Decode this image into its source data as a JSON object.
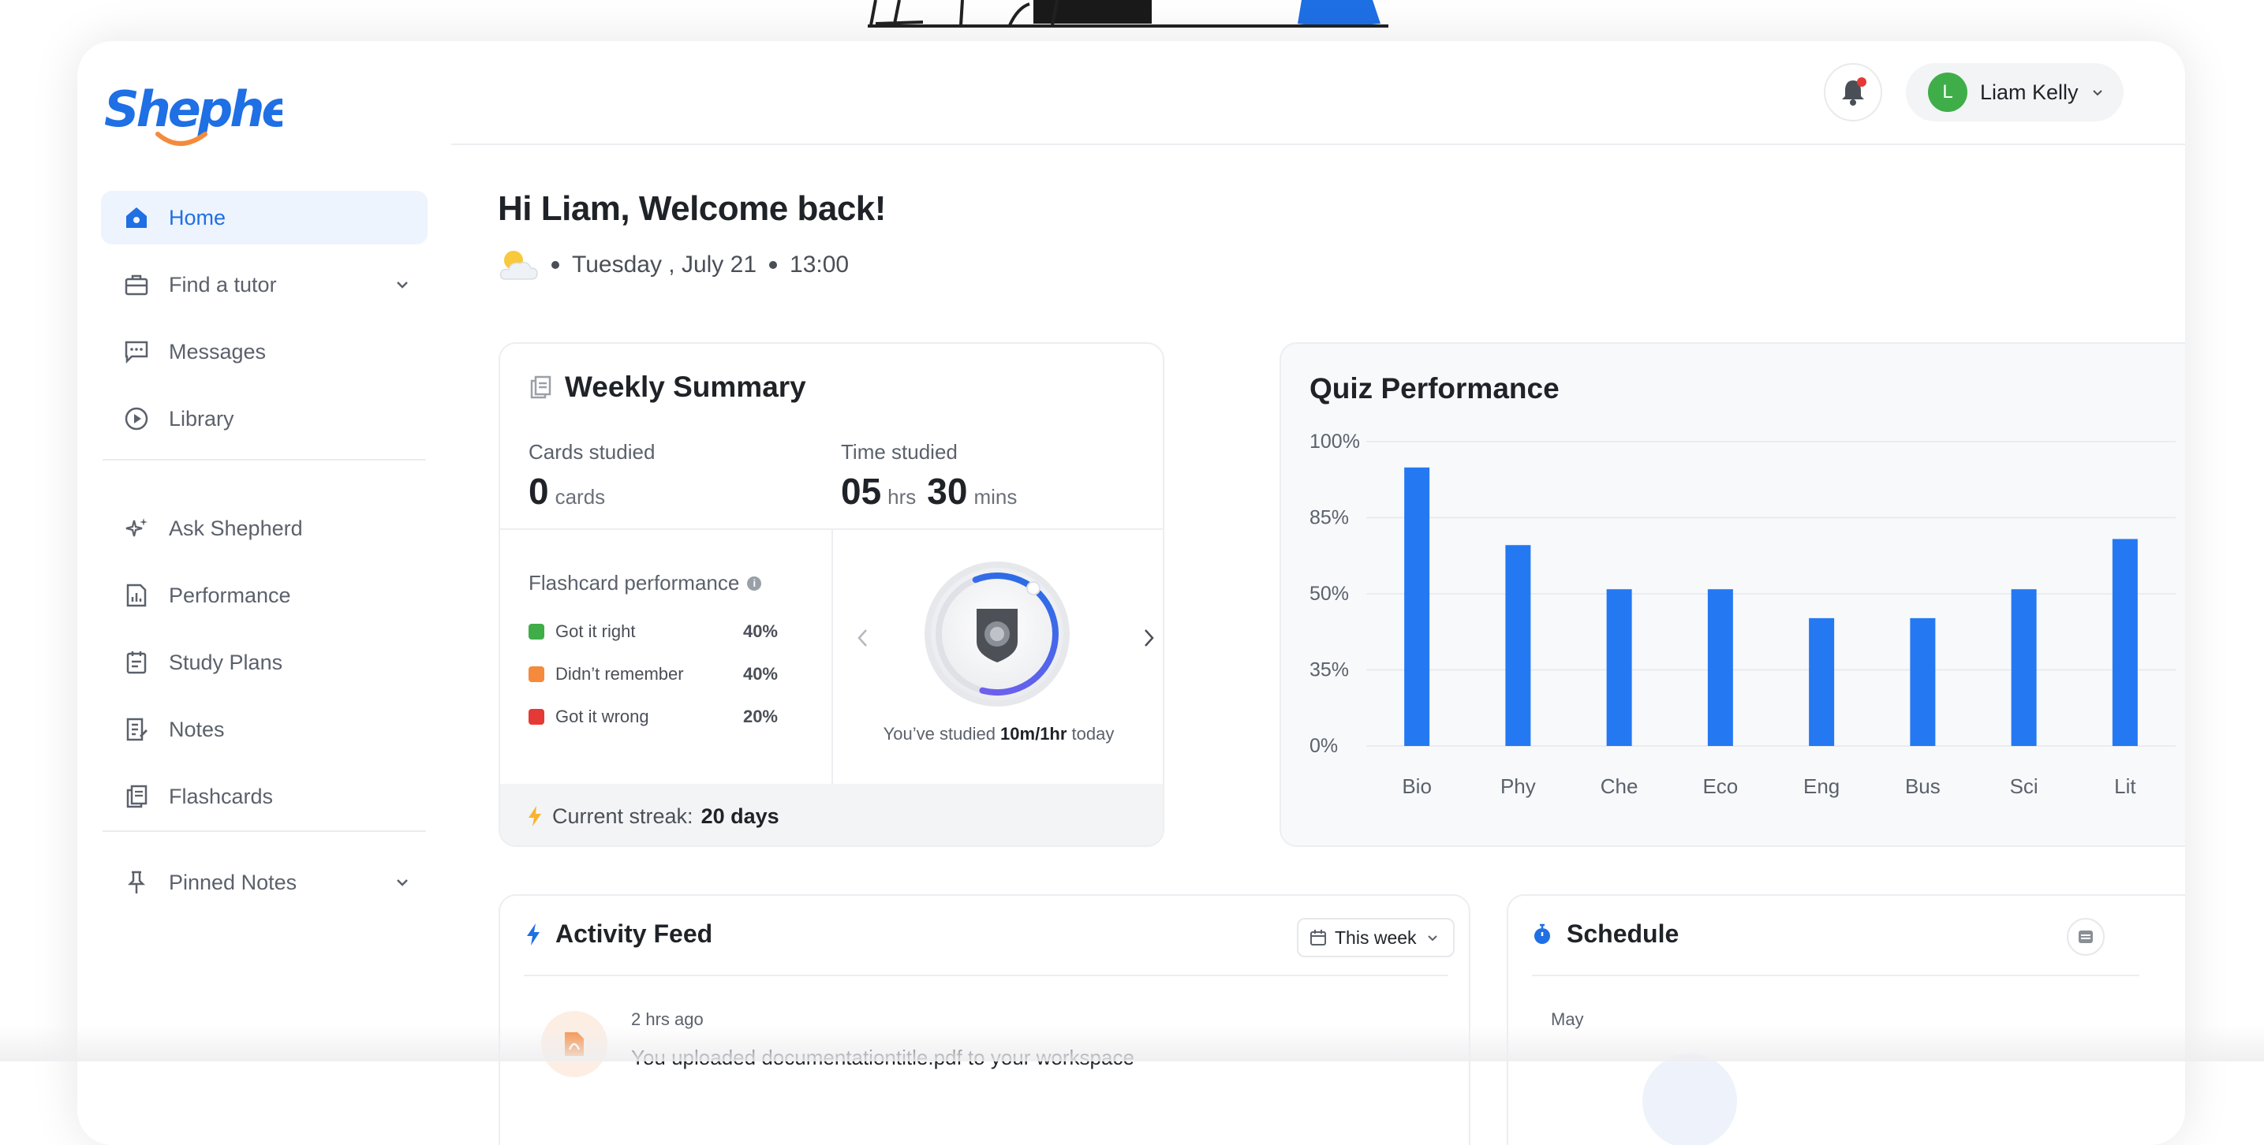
{
  "brand": {
    "name": "Shepherd"
  },
  "header": {
    "notification_icon": "bell-icon",
    "user": {
      "initial": "L",
      "name": "Liam Kelly",
      "avatar_color": "#3fae49"
    }
  },
  "sidebar": {
    "items": [
      {
        "label": "Home",
        "icon": "home-icon",
        "active": true
      },
      {
        "label": "Find a tutor",
        "icon": "briefcase-icon",
        "expandable": true
      },
      {
        "label": "Messages",
        "icon": "chat-icon"
      },
      {
        "label": "Library",
        "icon": "play-circle-icon"
      },
      {
        "label": "Ask Shepherd",
        "icon": "sparkle-icon"
      },
      {
        "label": "Performance",
        "icon": "chart-doc-icon"
      },
      {
        "label": "Study Plans",
        "icon": "clipboard-icon"
      },
      {
        "label": "Notes",
        "icon": "note-icon"
      },
      {
        "label": "Flashcards",
        "icon": "cards-icon"
      },
      {
        "label": "Pinned Notes",
        "icon": "pin-icon",
        "expandable": true
      }
    ]
  },
  "welcome": {
    "greeting": "Hi Liam, Welcome back!",
    "day": "Tuesday , July 21",
    "time": "13:00",
    "weather_icon": "partly-cloudy-icon"
  },
  "weekly_summary": {
    "title": "Weekly Summary",
    "cards_label": "Cards studied",
    "cards_value": "0",
    "cards_unit": "cards",
    "time_label": "Time studied",
    "hours_value": "05",
    "hours_unit": "hrs",
    "mins_value": "30",
    "mins_unit": "mins",
    "flashcard_title": "Flashcard performance",
    "performance": [
      {
        "label": "Got it right",
        "pct": "40%",
        "color": "#3fae49"
      },
      {
        "label": "Didn’t remember",
        "pct": "40%",
        "color": "#f58a3c"
      },
      {
        "label": "Got it wrong",
        "pct": "20%",
        "color": "#e53935"
      }
    ],
    "studied_prefix": "You’ve studied ",
    "studied_amount": "10m/1hr",
    "studied_suffix": " today",
    "progress": 0.6,
    "streak_label": "Current streak:",
    "streak_value": "20 days"
  },
  "quiz": {
    "title": "Quiz Performance"
  },
  "chart_data": {
    "type": "bar",
    "title": "Quiz Performance",
    "categories": [
      "Bio",
      "Phy",
      "Che",
      "Eco",
      "Eng",
      "Bus",
      "Sci",
      "Lit"
    ],
    "values": [
      91.5,
      66,
      51.5,
      51.5,
      42,
      42,
      51.5,
      68
    ],
    "y_ticks": [
      "100%",
      "85%",
      "50%",
      "35%",
      "0%"
    ],
    "ylim": [
      0,
      100
    ],
    "grid": true,
    "color": "#2479f2"
  },
  "activity": {
    "title": "Activity Feed",
    "filter": "This week",
    "items": [
      {
        "time": "2 hrs ago",
        "text": "You uploaded documentationtitle.pdf to your workspace",
        "icon": "pdf-icon"
      }
    ]
  },
  "schedule": {
    "title": "Schedule",
    "month": "May"
  }
}
